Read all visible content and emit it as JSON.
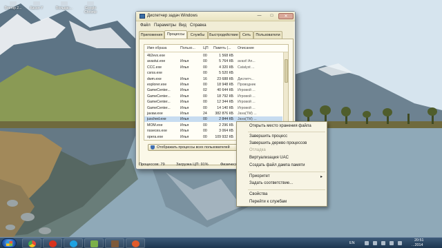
{
  "desktop": {
    "icons": [
      {
        "label": "Вектор 2..."
      },
      {
        "label": "Касел Y"
      },
      {
        "label": "Вольдас..."
      },
      {
        "label": "Google Chrome"
      }
    ]
  },
  "task_manager": {
    "title": "Диспетчер задач Windows",
    "menu": [
      "Файл",
      "Параметры",
      "Вид",
      "Справка"
    ],
    "tabs": [
      "Приложения",
      "Процессы",
      "Службы",
      "Быстродействие",
      "Сеть",
      "Пользователи"
    ],
    "active_tab": "Процессы",
    "columns": [
      "Имя образа",
      "Пользо...",
      "ЦП",
      "Память (...",
      "Описание"
    ],
    "processes": [
      {
        "name": "4li2evx.exe",
        "user": "",
        "cpu": "00",
        "mem": "1 568 КБ",
        "desc": ""
      },
      {
        "name": "avastui.exe",
        "user": "Илья",
        "cpu": "00",
        "mem": "5 764 КБ",
        "desc": "avast! An..."
      },
      {
        "name": "CCC.exe",
        "user": "Илья",
        "cpu": "00",
        "mem": "4 320 КБ",
        "desc": "Catalyst ..."
      },
      {
        "name": "csrss.exe",
        "user": "",
        "cpu": "00",
        "mem": "5 520 КБ",
        "desc": ""
      },
      {
        "name": "dwm.exe",
        "user": "Илья",
        "cpu": "16",
        "mem": "23 688 КБ",
        "desc": "Диспетч..."
      },
      {
        "name": "explorer.exe",
        "user": "Илья",
        "cpu": "00",
        "mem": "18 948 КБ",
        "desc": "Проводник"
      },
      {
        "name": "GameCenter...",
        "user": "Илья",
        "cpu": "02",
        "mem": "40 644 КБ",
        "desc": "Игровой ..."
      },
      {
        "name": "GameCenter...",
        "user": "Илья",
        "cpu": "00",
        "mem": "18 792 КБ",
        "desc": "Игровой ..."
      },
      {
        "name": "GameCenter...",
        "user": "Илья",
        "cpu": "00",
        "mem": "12 344 КБ",
        "desc": "Игровой ..."
      },
      {
        "name": "GameCenter...",
        "user": "Илья",
        "cpu": "00",
        "mem": "14 140 КБ",
        "desc": "Игровой ..."
      },
      {
        "name": "javaw.exe",
        "user": "Илья",
        "cpu": "24",
        "mem": "382 876 КБ",
        "desc": "Java(TM) ..."
      },
      {
        "name": "jusched.exe",
        "user": "Илья",
        "cpu": "00",
        "mem": "2 844 КБ",
        "desc": "Java(TM) ..."
      },
      {
        "name": "MOM.exe",
        "user": "Илья",
        "cpu": "00",
        "mem": "2 296 КБ",
        "desc": "Catalyst ..."
      },
      {
        "name": "nsseces.exe",
        "user": "Илья",
        "cpu": "00",
        "mem": "3 064 КБ",
        "desc": "Microsoft..."
      },
      {
        "name": "opera.exe",
        "user": "Илья",
        "cpu": "00",
        "mem": "109 932 КБ",
        "desc": "Opera In..."
      }
    ],
    "show_all_users_button": "Отображать процессы всех пользователей",
    "status": {
      "processes": "Процессов: 79",
      "cpu": "Загрузка ЦП: 91%",
      "memory": "Физическ..."
    }
  },
  "context_menu": {
    "items": [
      {
        "label": "Открыть место хранения файла",
        "disabled": false
      },
      {
        "label": "Завершить процесс",
        "disabled": false
      },
      {
        "label": "Завершить дерево процессов",
        "disabled": false
      },
      {
        "label": "Отладка",
        "disabled": true
      },
      {
        "label": "Виртуализация UAC",
        "disabled": false
      },
      {
        "label": "Создать файл дампа памяти",
        "disabled": false
      },
      {
        "label": "Приоритет",
        "disabled": false,
        "submenu": true
      },
      {
        "label": "Задать соответствие...",
        "disabled": false
      },
      {
        "label": "Свойства",
        "disabled": false
      },
      {
        "label": "Перейти к службам",
        "disabled": false
      }
    ]
  },
  "taskbar": {
    "language": "EN",
    "time": "20:51",
    "date": "...2014"
  },
  "colors": {
    "window_bg": "#f1edd6",
    "selection": "#c7dcf0",
    "taskbar": "#1d3650"
  }
}
